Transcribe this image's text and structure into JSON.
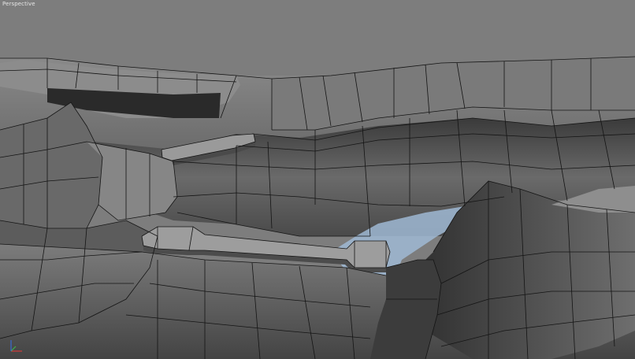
{
  "viewport": {
    "label": "Perspective",
    "background_color": "#7d7d7d",
    "mesh_color": "#6e6e6e",
    "edge_color": "#141414",
    "water_color": "#9fb8d4"
  },
  "axis_gizmo": {
    "x_axis_color": "#d23a3a",
    "y_axis_color": "#3fb04a",
    "z_axis_color": "#3a6ad2"
  }
}
